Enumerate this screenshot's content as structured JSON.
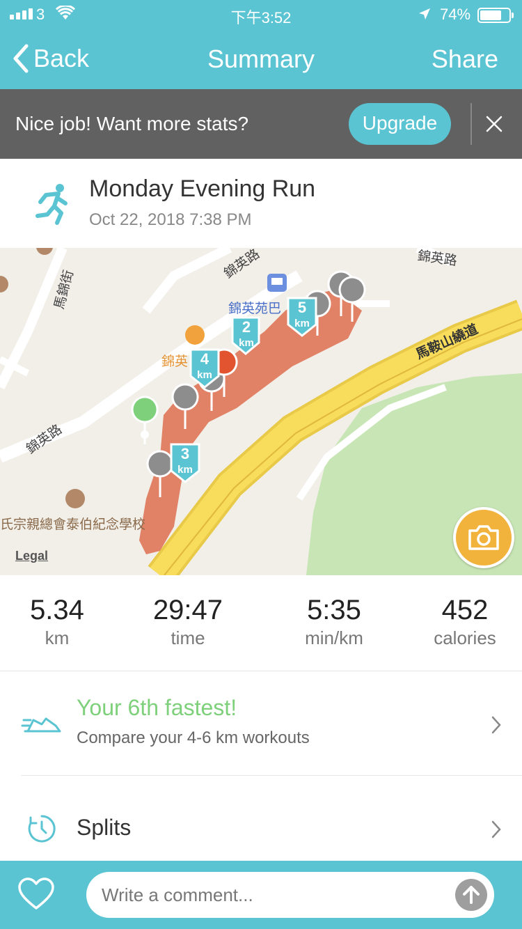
{
  "status_bar": {
    "carrier": "3",
    "time": "下午3:52",
    "battery": "74%"
  },
  "nav": {
    "back_label": "Back",
    "title": "Summary",
    "share_label": "Share"
  },
  "banner": {
    "message": "Nice job! Want more stats?",
    "upgrade_label": "Upgrade"
  },
  "activity": {
    "name": "Monday Evening Run",
    "datetime": "Oct 22, 2018 7:38 PM"
  },
  "map": {
    "labels": [
      "錦英路",
      "馬錦街",
      "錦英苑巴",
      "錦英",
      "馬鞍山繞道",
      "錦英路",
      "氏宗親總會泰伯紀念學校",
      "錦英路"
    ],
    "km_markers": [
      "2",
      "3",
      "4",
      "5"
    ],
    "km_unit": "km",
    "legal": "Legal",
    "route_color": "#e0775a"
  },
  "stats": [
    {
      "value": "5.34",
      "unit": "km"
    },
    {
      "value": "29:47",
      "unit": "time"
    },
    {
      "value": "5:35",
      "unit": "min/km"
    },
    {
      "value": "452",
      "unit": "calories"
    }
  ],
  "fastest": {
    "headline": "Your 6th fastest!",
    "sub": "Compare your 4-6 km workouts"
  },
  "splits": {
    "label": "Splits"
  },
  "comment": {
    "placeholder": "Write a comment..."
  },
  "colors": {
    "accent": "#5bc4d3",
    "banner": "#616161",
    "success": "#7ed07b",
    "camera": "#f2b33d"
  }
}
